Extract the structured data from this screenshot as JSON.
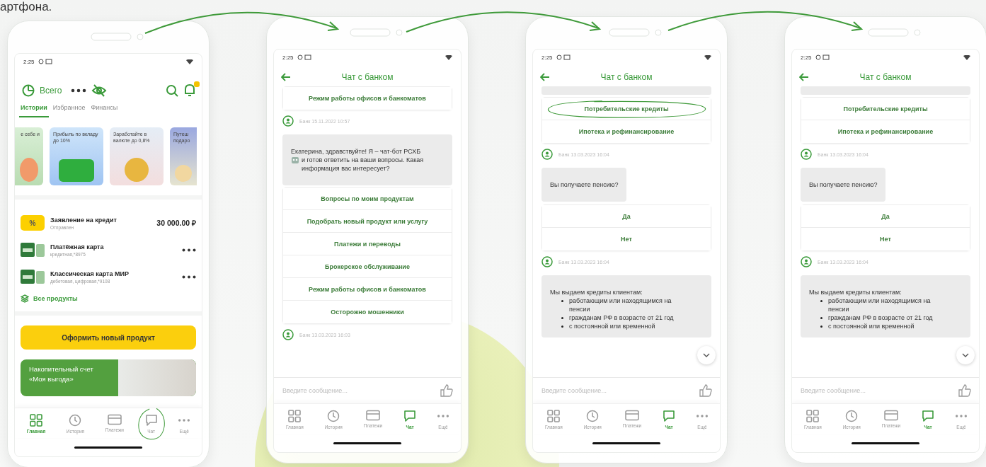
{
  "caption": "артфона.",
  "phones": [
    {
      "kind": "home",
      "time": "2:25",
      "total_label": "Всего",
      "tabs": [
        {
          "label": "Истории",
          "selected": true
        },
        {
          "label": "Избранное",
          "selected": false
        },
        {
          "label": "Финансы",
          "selected": false
        }
      ],
      "stories": [
        {
          "text": "е себе и"
        },
        {
          "text": "Прибыль по вкладу до 10%"
        },
        {
          "text": "Заработайте в валюте до 0,8%"
        },
        {
          "text": "Путеш подаро"
        }
      ],
      "products": [
        {
          "kind": "application",
          "icon_text": "%",
          "title": "Заявление на кредит",
          "subtitle": "Отправлен",
          "amount": "30 000.00 ₽"
        },
        {
          "kind": "card",
          "title": "Платёжная карта",
          "subtitle": "кредитная,*8975"
        },
        {
          "kind": "card",
          "title": "Классическая карта МИР",
          "subtitle": "дебетовая, цифровая,*9108"
        }
      ],
      "all_products": "Все продукты",
      "cta": "Оформить новый продукт",
      "promo": {
        "title": "Накопительный счет",
        "name": "«Моя выгода»"
      },
      "nav": [
        {
          "label": "Главная",
          "selected": true,
          "circled": false
        },
        {
          "label": "История",
          "selected": false,
          "circled": false
        },
        {
          "label": "Платежи",
          "selected": false,
          "circled": false
        },
        {
          "label": "Чат",
          "selected": false,
          "circled": true
        },
        {
          "label": "Ещё",
          "selected": false,
          "circled": false
        }
      ]
    },
    {
      "kind": "chat",
      "time": "2:25",
      "title": "Чат с банком",
      "feed": [
        {
          "kind": "options",
          "options": [
            {
              "label": "Режим работы офисов и банкоматов",
              "circled": false
            }
          ]
        },
        {
          "kind": "meta",
          "text": "Банк 15.11.2022 10:57"
        },
        {
          "kind": "bubble",
          "text": "Екатерина, здравствуйте! Я – чат-бот РСХБ",
          "text_after_icon": "и готов ответить на ваши вопросы. Какая информация вас интересует?"
        },
        {
          "kind": "options",
          "options": [
            {
              "label": "Вопросы по моим продуктам",
              "circled": false
            },
            {
              "label": "Подобрать новый продукт или услугу",
              "circled": false
            },
            {
              "label": "Платежи и переводы",
              "circled": false
            },
            {
              "label": "Брокерское обслуживание",
              "circled": false
            },
            {
              "label": "Режим работы офисов и банкоматов",
              "circled": false
            },
            {
              "label": "Осторожно мошенники",
              "circled": false
            }
          ]
        },
        {
          "kind": "meta",
          "text": "Банк 13.03.2023 16:03"
        }
      ],
      "input_placeholder": "Введите сообщение...",
      "scroll_button": false,
      "nav": [
        {
          "label": "Главная",
          "selected": false,
          "circled": false
        },
        {
          "label": "История",
          "selected": false,
          "circled": false
        },
        {
          "label": "Платежи",
          "selected": false,
          "circled": false
        },
        {
          "label": "Чат",
          "selected": true,
          "circled": false
        },
        {
          "label": "Ещё",
          "selected": false,
          "circled": false
        }
      ]
    },
    {
      "kind": "chat",
      "time": "2:25",
      "title": "Чат с банком",
      "feed": [
        {
          "kind": "stub"
        },
        {
          "kind": "options",
          "options": [
            {
              "label": "Потребительские кредиты",
              "circled": true
            },
            {
              "label": "Ипотека и рефинансирование",
              "circled": false
            }
          ]
        },
        {
          "kind": "meta",
          "text": "Банк 13.03.2023 16:04"
        },
        {
          "kind": "bubble",
          "text": "Вы получаете пенсию?"
        },
        {
          "kind": "options",
          "options": [
            {
              "label": "Да",
              "circled": false
            },
            {
              "label": "Нет",
              "circled": false
            }
          ]
        },
        {
          "kind": "meta",
          "text": "Банк 13.03.2023 16:04"
        },
        {
          "kind": "list_bubble",
          "text": "Мы выдаем кредиты клиентам:",
          "items": [
            "работающим или находящимся на пенсии",
            "гражданам РФ в возрасте от 21 год",
            "с постоянной или временной"
          ]
        }
      ],
      "input_placeholder": "Введите сообщение...",
      "scroll_button": true,
      "nav": [
        {
          "label": "Главная",
          "selected": false,
          "circled": false
        },
        {
          "label": "История",
          "selected": false,
          "circled": false
        },
        {
          "label": "Платежи",
          "selected": false,
          "circled": false
        },
        {
          "label": "Чат",
          "selected": true,
          "circled": false
        },
        {
          "label": "Ещё",
          "selected": false,
          "circled": false
        }
      ]
    },
    {
      "kind": "chat",
      "time": "2:25",
      "title": "Чат с банком",
      "feed": [
        {
          "kind": "stub"
        },
        {
          "kind": "options",
          "options": [
            {
              "label": "Потребительские кредиты",
              "circled": false
            },
            {
              "label": "Ипотека и рефинансирование",
              "circled": false
            }
          ]
        },
        {
          "kind": "meta",
          "text": "Банк 13.03.2023 16:04"
        },
        {
          "kind": "bubble",
          "text": "Вы получаете пенсию?"
        },
        {
          "kind": "options",
          "options": [
            {
              "label": "Да",
              "circled": false
            },
            {
              "label": "Нет",
              "circled": false
            }
          ]
        },
        {
          "kind": "meta",
          "text": "Банк 13.03.2023 16:04"
        },
        {
          "kind": "list_bubble",
          "text": "Мы выдаем кредиты клиентам:",
          "items": [
            "работающим или находящимся на пенсии",
            "гражданам РФ в возрасте от 21 год",
            "с постоянной или временной"
          ]
        }
      ],
      "input_placeholder": "Введите сообщение...",
      "scroll_button": true,
      "nav": [
        {
          "label": "Главная",
          "selected": false,
          "circled": false
        },
        {
          "label": "История",
          "selected": false,
          "circled": false
        },
        {
          "label": "Платежи",
          "selected": false,
          "circled": false
        },
        {
          "label": "Чат",
          "selected": true,
          "circled": false
        },
        {
          "label": "Ещё",
          "selected": false,
          "circled": false
        }
      ]
    }
  ]
}
